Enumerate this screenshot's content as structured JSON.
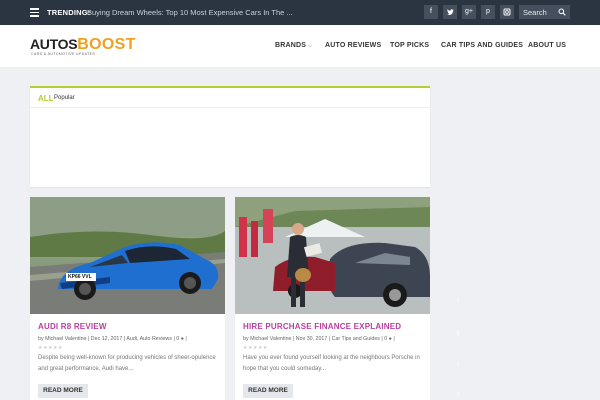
{
  "topbar": {
    "trending_label": "TRENDING:",
    "trending_text": "Buying Dream Wheels: Top 10 Most Expensive Cars In The ...",
    "social": [
      "f",
      "t",
      "g+",
      "p",
      "ig"
    ],
    "search_label": "Search"
  },
  "header": {
    "logo_autos": "AUTOS",
    "logo_boost": "BOOST",
    "logo_tagline": "CARS & AUTOMOTIVE UPDATES",
    "nav": [
      "BRANDS",
      "AUTO REVIEWS",
      "TOP PICKS",
      "CAR TIPS AND GUIDES",
      "ABOUT US"
    ]
  },
  "tabs": {
    "all": "ALL",
    "popular": "Popular"
  },
  "posts": [
    {
      "title": "AUDI R8 REVIEW",
      "meta": "by Michael Valentine | Dec 12, 2017 | Audi, Auto Reviews | 0 ● |",
      "plate": "KP66 VVL",
      "excerpt": "Despite being well-known for producing vehicles of sheer-opulence and great performance, Audi have...",
      "button": "READ MORE"
    },
    {
      "title": "HIRE PURCHASE FINANCE EXPLAINED",
      "meta": "by Michael Valentine | Nov 30, 2017 | Car Tips and Guides | 0 ● |",
      "excerpt": "Have you ever found yourself looking at the neighbours Porsche in hope that you could someday...",
      "button": "READ MORE"
    }
  ],
  "stars_glyph": "★★★★★",
  "colors": {
    "topbar": "#2b3441",
    "accent_green": "#b6cd2e",
    "logo_orange": "#f0a11f",
    "title_magenta": "#b83fa0"
  }
}
